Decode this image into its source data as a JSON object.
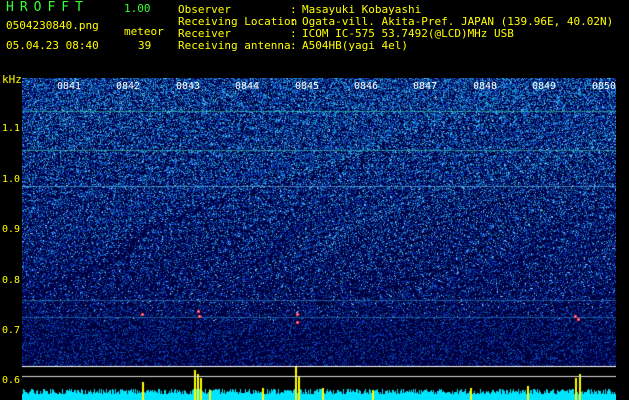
{
  "header": {
    "app_title": "HROFFT",
    "version": "1.00",
    "filename": "0504230840.png",
    "timestamp": "05.04.23 08:40",
    "count_label": "meteor",
    "count_value": "39"
  },
  "info": [
    {
      "key": "Observer",
      "value": "Masayuki Kobayashi"
    },
    {
      "key": "Receiving Location",
      "value": "Ogata-vill. Akita-Pref. JAPAN (139.96E, 40.02N)"
    },
    {
      "key": "Receiver",
      "value": "ICOM IC-575 53.7492(@LCD)MHz USB"
    },
    {
      "key": "Receiving antenna",
      "value": "A504HB(yagi 4el)"
    }
  ],
  "spectrogram": {
    "y_unit": "kHz",
    "y_ticks": [
      "1.1",
      "1.0",
      "0.9",
      "0.8",
      "0.7",
      "0.6"
    ],
    "x_ticks": [
      "0841",
      "0842",
      "0843",
      "0844",
      "0845",
      "0846",
      "0847",
      "0848",
      "0849",
      "0850"
    ],
    "colors": {
      "background": "#000000",
      "label": "#ffff00",
      "time_label": "#ffffff",
      "app_title": "#33ff33",
      "bar_level": "#00e5ff",
      "bar_peak": "#ffff00"
    }
  }
}
